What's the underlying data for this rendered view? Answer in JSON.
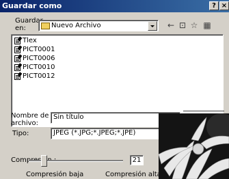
{
  "window": {
    "title": "Guardar como",
    "help_btn": "?",
    "close_btn": "×"
  },
  "location": {
    "label": "Guardar en:",
    "value": "Nuevo Archivo"
  },
  "toolbar": {
    "back_icon": "←",
    "up_icon": "⊡",
    "newfolder_icon": "☆",
    "views_icon": "▦"
  },
  "files": [
    "Tlex",
    "PICT0001",
    "PICT0006",
    "PICT0010",
    "PICT0012"
  ],
  "filename": {
    "label": "Nombre de archivo:",
    "value": "Sin título"
  },
  "filetype": {
    "label": "Tipo:",
    "value": "JPEG (*.JPG;*.JPEG;*.JPE)"
  },
  "compression": {
    "label": "Compresión :",
    "value": "21",
    "low_label": "Compresión baja",
    "high_label": "Compresión alta"
  }
}
